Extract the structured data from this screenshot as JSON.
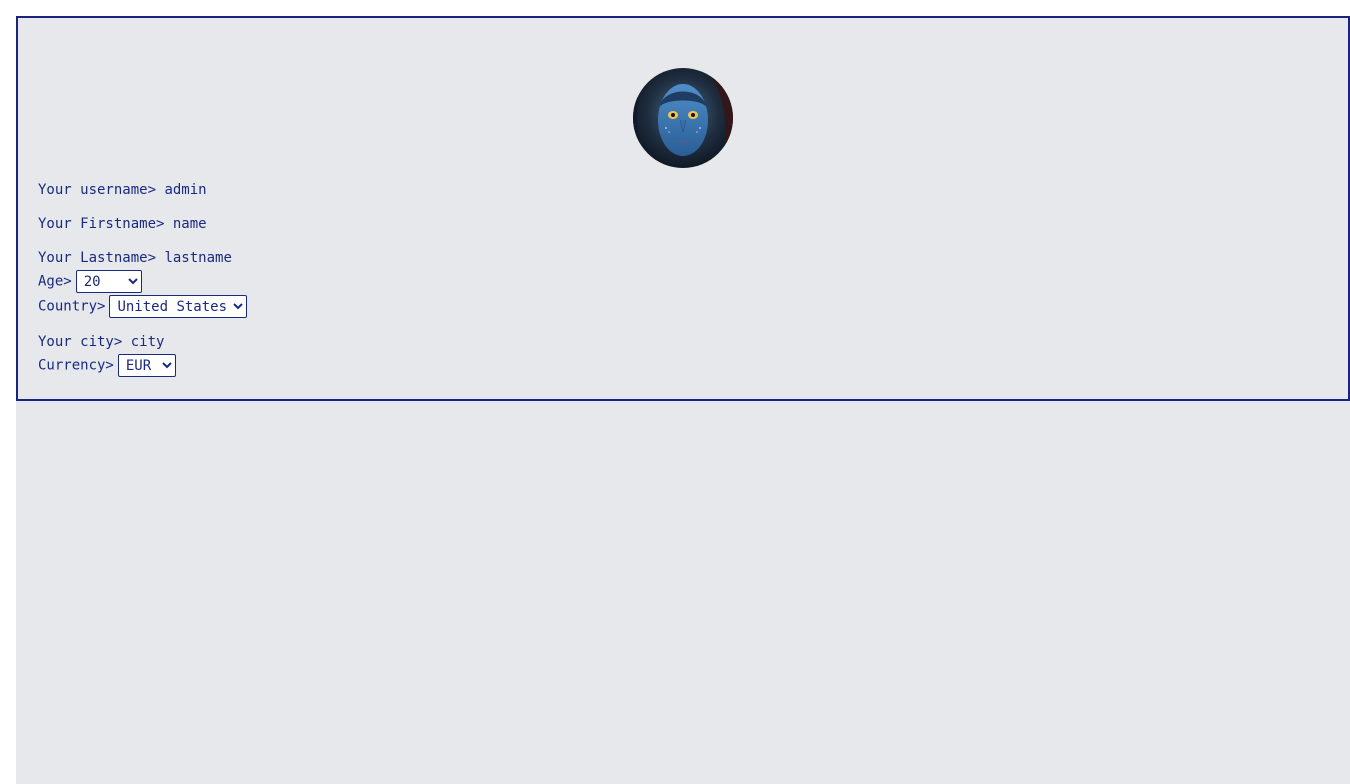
{
  "profile": {
    "avatar_icon": "avatar-face-icon",
    "username": {
      "label": "Your username>",
      "value": "admin"
    },
    "firstname": {
      "label": "Your Firstname>",
      "value": "name"
    },
    "lastname": {
      "label": "Your Lastname>",
      "value": "lastname"
    },
    "age": {
      "label": "Age>",
      "selected": "20"
    },
    "country": {
      "label": "Country>",
      "selected": "United States"
    },
    "city": {
      "label": "Your city>",
      "value": "city"
    },
    "currency": {
      "label": "Currency>",
      "selected": "EUR"
    }
  },
  "colors": {
    "text": "#1a2a80",
    "border": "#1a2380",
    "background": "#e7e8eb"
  }
}
